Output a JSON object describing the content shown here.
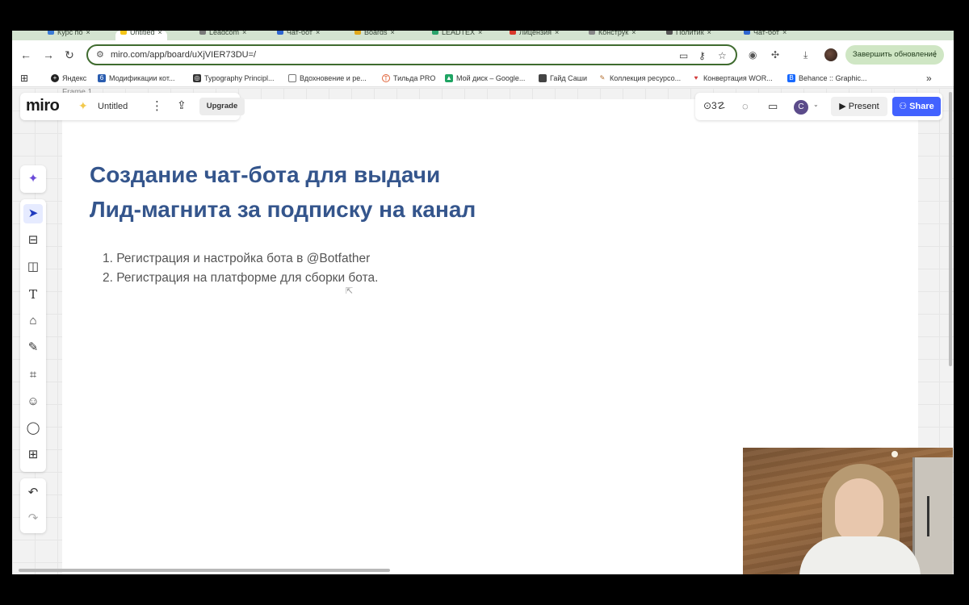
{
  "browser": {
    "tabs": [
      {
        "label": "Курс по",
        "active": false
      },
      {
        "label": "Untitled",
        "active": true
      },
      {
        "label": "Leadcom",
        "active": false
      },
      {
        "label": "Чат-бот",
        "active": false
      },
      {
        "label": "Boards",
        "active": false
      },
      {
        "label": "LEADTEX",
        "active": false
      },
      {
        "label": "Лицензия",
        "active": false
      },
      {
        "label": "Конструк",
        "active": false
      },
      {
        "label": "Политик",
        "active": false
      },
      {
        "label": "Чат-бот",
        "active": false
      }
    ],
    "url": "miro.com/app/board/uXjVIER73DU=/",
    "update_button": "Завершить обновление",
    "bookmarks": [
      {
        "label": "Яндекс",
        "icon": "yandex-icon",
        "color": "#222222"
      },
      {
        "label": "Модификации кот...",
        "icon": "tilda-icon",
        "color": "#2a5db0"
      },
      {
        "label": "Typography Principl...",
        "icon": "typography-icon",
        "color": "#333333"
      },
      {
        "label": "Вдохновение и ре...",
        "icon": "folder-icon",
        "color": "#555555"
      },
      {
        "label": "Тильда PRO",
        "icon": "tilda-pro-icon",
        "color": "#e0643a"
      },
      {
        "label": "Мой диск – Google...",
        "icon": "google-drive-icon",
        "color": "#1fa463"
      },
      {
        "label": "Гайд Саши",
        "icon": "guide-icon",
        "color": "#444444"
      },
      {
        "label": "Коллекция ресурсо...",
        "icon": "collection-icon",
        "color": "#b06a2a"
      },
      {
        "label": "Конвертация WOR...",
        "icon": "convert-icon",
        "color": "#d13a3a"
      },
      {
        "label": "Behance :: Graphic...",
        "icon": "behance-icon",
        "color": "#1769ff"
      }
    ]
  },
  "miro": {
    "logo": "miro",
    "board_title": "Untitled",
    "upgrade_label": "Upgrade",
    "present_label": "Present",
    "share_label": "Share",
    "avatar_initial": "C",
    "frame_label": "Frame 1",
    "slide": {
      "title_lines": [
        "Создание чат-бота для выдачи",
        "Лид-магнита за подписку на канал"
      ],
      "steps": [
        "1. Регистрация и настройка бота в @Botfather",
        "2. Регистрация на платформе для сборки бота."
      ]
    },
    "colors": {
      "title": "#34558c",
      "share": "#4262ff"
    }
  }
}
